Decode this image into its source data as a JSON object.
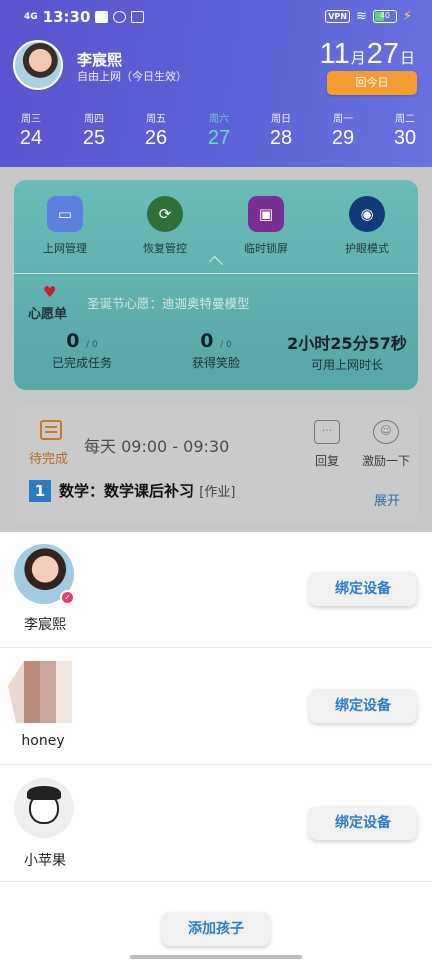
{
  "status_bar": {
    "signal": "4G",
    "time": "13:30",
    "vpn": "VPN",
    "battery": "40"
  },
  "header": {
    "kid_name": "李宸熙",
    "kid_subtitle": "自由上网（今日生效）",
    "month": "11",
    "month_unit": "月",
    "day": "27",
    "day_unit": "日",
    "today_button": "回今日"
  },
  "week": [
    {
      "weekday": "周三",
      "date": "24"
    },
    {
      "weekday": "周四",
      "date": "25"
    },
    {
      "weekday": "周五",
      "date": "26"
    },
    {
      "weekday": "周六",
      "date": "27"
    },
    {
      "weekday": "周日",
      "date": "28"
    },
    {
      "weekday": "周一",
      "date": "29"
    },
    {
      "weekday": "周二",
      "date": "30"
    }
  ],
  "functions": [
    {
      "label": "上网管理",
      "icon": "monitor-icon",
      "color": "#5d7fe0"
    },
    {
      "label": "恢复管控",
      "icon": "restore-icon",
      "color": "#2f6f3a"
    },
    {
      "label": "临时锁屏",
      "icon": "lock-icon",
      "color": "#7a2f95"
    },
    {
      "label": "护眼模式",
      "icon": "eye-icon",
      "color": "#123a78"
    }
  ],
  "wish": {
    "label": "心愿单",
    "text": "圣诞节心愿：迪迦奥特曼模型"
  },
  "stats": [
    {
      "value": "0",
      "suffix": "/ 0",
      "label": "已完成任务"
    },
    {
      "value": "0",
      "suffix": "/ 0",
      "label": "获得笑脸"
    },
    {
      "value": "2小时25分57秒",
      "suffix": "",
      "label": "可用上网时长"
    }
  ],
  "task": {
    "status_label": "待完成",
    "schedule": "每天 09:00 - 09:30",
    "reply": "回复",
    "encourage": "激励一下",
    "number": "1",
    "title": "数学：数学课后补习",
    "tag": "[作业]",
    "expand": "展开"
  },
  "children": [
    {
      "name": "李宸熙",
      "bind": "绑定设备"
    },
    {
      "name": "honey",
      "bind": "绑定设备"
    },
    {
      "name": "小苹果",
      "bind": "绑定设备"
    }
  ],
  "add_child": "添加孩子"
}
